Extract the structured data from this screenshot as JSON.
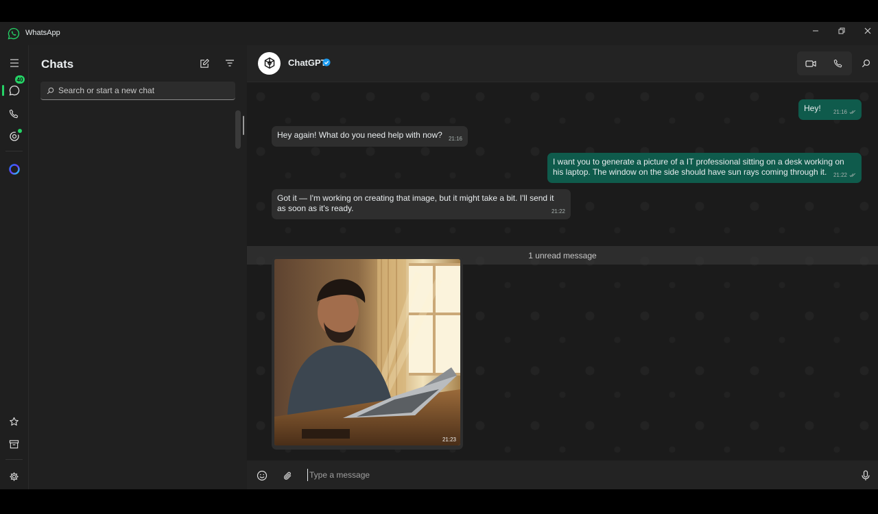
{
  "app": {
    "title": "WhatsApp"
  },
  "rail": {
    "chats_badge": "40"
  },
  "list": {
    "title": "Chats",
    "search_placeholder": "Search or start a new chat"
  },
  "contact": {
    "name": "ChatGPT"
  },
  "messages": [
    {
      "dir": "out",
      "text": "Hey!",
      "time": "21:16"
    },
    {
      "dir": "in",
      "text": "Hey again! What do you need help with now?",
      "time": "21:16"
    },
    {
      "dir": "out",
      "text": "I want you to generate a picture of a IT professional sitting on a desk working on his laptop. The window on the side should have sun rays coming through it.",
      "time": "21:22"
    },
    {
      "dir": "in",
      "text": "Got it — I'm working on creating that image, but it might take a bit. I'll send it as soon as it's ready.",
      "time": "21:22"
    }
  ],
  "unread": "1 unread message",
  "image_message": {
    "time": "21:23"
  },
  "composer": {
    "placeholder": "Type a message"
  },
  "colors": {
    "accent": "#25d366",
    "outgoing_bubble": "#0f5b4c",
    "incoming_bubble": "#2e2e2e",
    "verified": "#1d9bf0"
  }
}
